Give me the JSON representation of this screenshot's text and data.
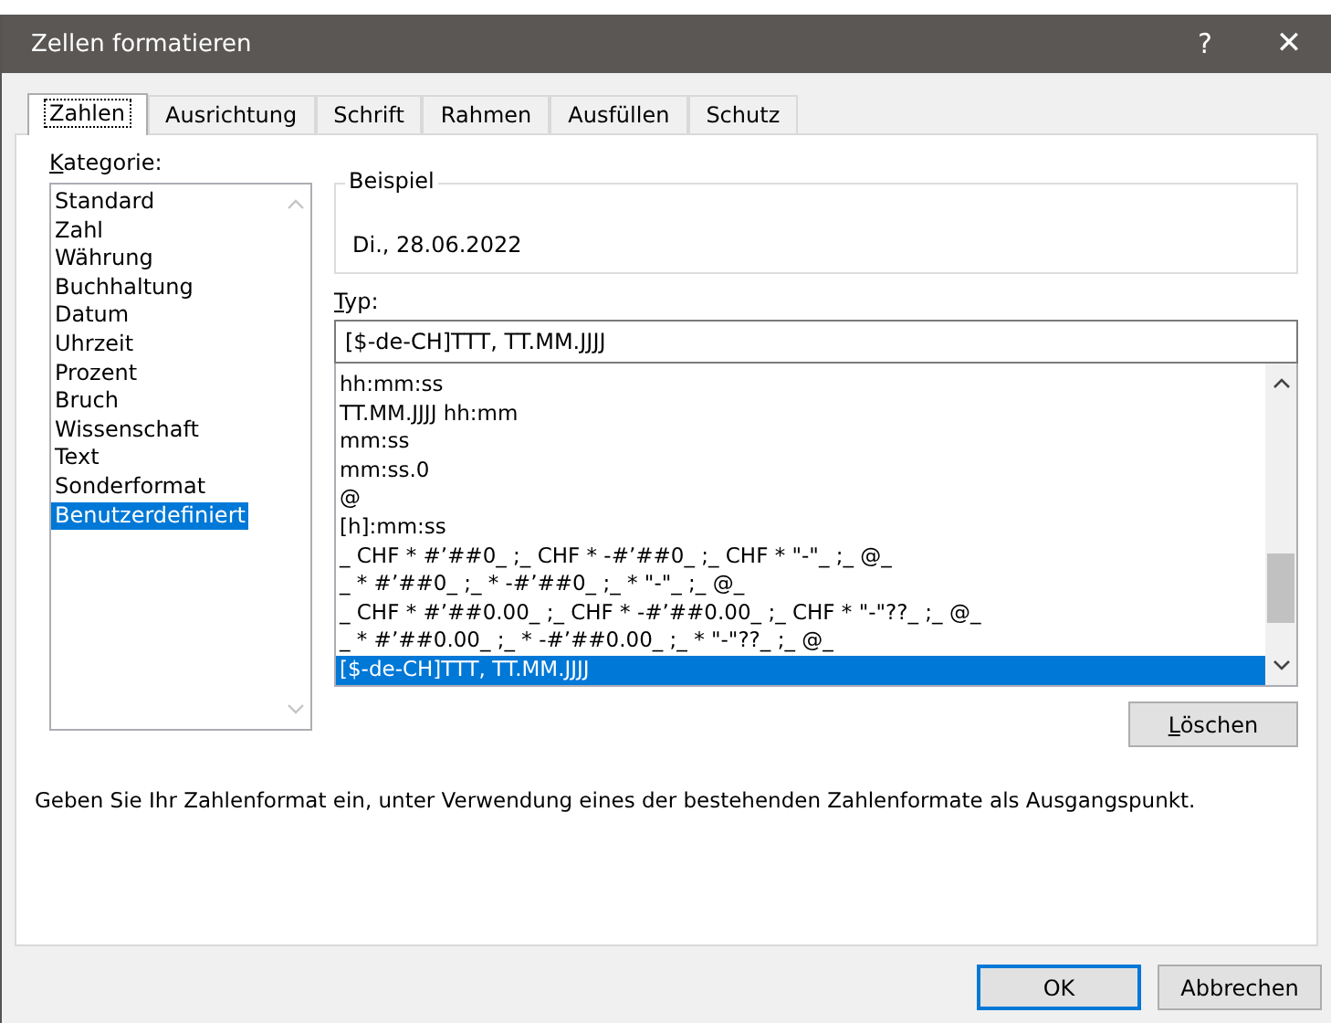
{
  "window": {
    "title": "Zellen formatieren",
    "help": "?",
    "close": "✕"
  },
  "tabs": [
    {
      "label": "Zahlen",
      "selected": true
    },
    {
      "label": "Ausrichtung",
      "selected": false
    },
    {
      "label": "Schrift",
      "selected": false
    },
    {
      "label": "Rahmen",
      "selected": false
    },
    {
      "label": "Ausfüllen",
      "selected": false
    },
    {
      "label": "Schutz",
      "selected": false
    }
  ],
  "category": {
    "label": "Kategorie:",
    "items": [
      {
        "label": "Standard",
        "selected": false
      },
      {
        "label": "Zahl",
        "selected": false
      },
      {
        "label": "Währung",
        "selected": false
      },
      {
        "label": "Buchhaltung",
        "selected": false
      },
      {
        "label": "Datum",
        "selected": false
      },
      {
        "label": "Uhrzeit",
        "selected": false
      },
      {
        "label": "Prozent",
        "selected": false
      },
      {
        "label": "Bruch",
        "selected": false
      },
      {
        "label": "Wissenschaft",
        "selected": false
      },
      {
        "label": "Text",
        "selected": false
      },
      {
        "label": "Sonderformat",
        "selected": false
      },
      {
        "label": "Benutzerdefiniert",
        "selected": true
      }
    ]
  },
  "sample": {
    "label": "Beispiel",
    "value": "Di., 28.06.2022"
  },
  "type": {
    "label": "Typ:",
    "value": "[$-de-CH]TTT, TT.MM.JJJJ",
    "items": [
      {
        "label": "hh:mm:ss",
        "selected": false
      },
      {
        "label": "TT.MM.JJJJ hh:mm",
        "selected": false
      },
      {
        "label": "mm:ss",
        "selected": false
      },
      {
        "label": "mm:ss.0",
        "selected": false
      },
      {
        "label": "@",
        "selected": false
      },
      {
        "label": "[h]:mm:ss",
        "selected": false
      },
      {
        "label": "_ CHF * #’##0_ ;_ CHF * -#’##0_ ;_ CHF * \"-\"_ ;_ @_",
        "selected": false
      },
      {
        "label": "_ * #’##0_ ;_ * -#’##0_ ;_ * \"-\"_ ;_ @_",
        "selected": false
      },
      {
        "label": "_ CHF * #’##0.00_ ;_ CHF * -#’##0.00_ ;_ CHF * \"-\"??_ ;_ @_",
        "selected": false
      },
      {
        "label": "_ * #’##0.00_ ;_ * -#’##0.00_ ;_ * \"-\"??_ ;_ @_",
        "selected": false
      },
      {
        "label": "[$-de-CH]TTT, TT.MM.JJJJ",
        "selected": true
      }
    ]
  },
  "delete_button": "Löschen",
  "description": "Geben Sie Ihr Zahlenformat ein, unter Verwendung eines der bestehenden Zahlenformate als Ausgangspunkt.",
  "buttons": [
    {
      "label": "OK",
      "kind": "default"
    },
    {
      "label": "Abbrechen",
      "kind": "normal"
    }
  ]
}
